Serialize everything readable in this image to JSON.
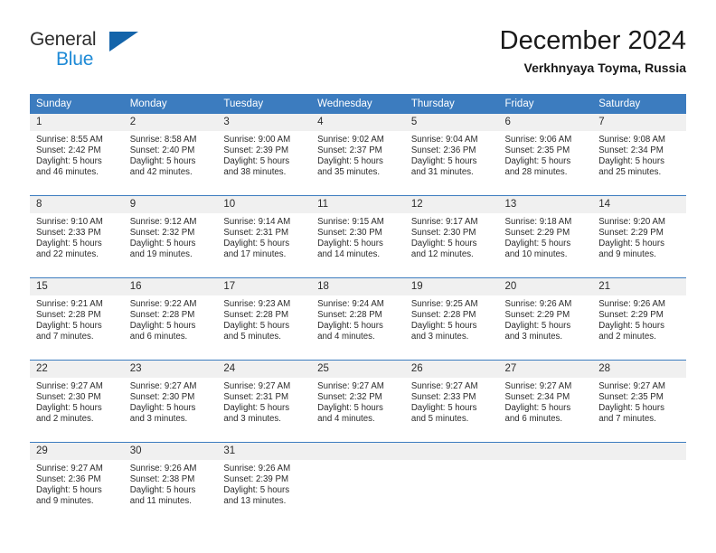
{
  "brand": {
    "name_part1": "General",
    "name_part2": "Blue",
    "triangle_color": "#1464aa",
    "blue_color": "#1e8ad6"
  },
  "header": {
    "title": "December 2024",
    "subtitle": "Verkhnyaya Toyma, Russia"
  },
  "theme": {
    "header_blue": "#3c7cbf",
    "daynum_gray": "#f0f0f0",
    "text_color": "#2b2b2b"
  },
  "weekdays": [
    "Sunday",
    "Monday",
    "Tuesday",
    "Wednesday",
    "Thursday",
    "Friday",
    "Saturday"
  ],
  "weeks": [
    [
      {
        "day": "1",
        "sunrise": "Sunrise: 8:55 AM",
        "sunset": "Sunset: 2:42 PM",
        "daylight1": "Daylight: 5 hours",
        "daylight2": "and 46 minutes."
      },
      {
        "day": "2",
        "sunrise": "Sunrise: 8:58 AM",
        "sunset": "Sunset: 2:40 PM",
        "daylight1": "Daylight: 5 hours",
        "daylight2": "and 42 minutes."
      },
      {
        "day": "3",
        "sunrise": "Sunrise: 9:00 AM",
        "sunset": "Sunset: 2:39 PM",
        "daylight1": "Daylight: 5 hours",
        "daylight2": "and 38 minutes."
      },
      {
        "day": "4",
        "sunrise": "Sunrise: 9:02 AM",
        "sunset": "Sunset: 2:37 PM",
        "daylight1": "Daylight: 5 hours",
        "daylight2": "and 35 minutes."
      },
      {
        "day": "5",
        "sunrise": "Sunrise: 9:04 AM",
        "sunset": "Sunset: 2:36 PM",
        "daylight1": "Daylight: 5 hours",
        "daylight2": "and 31 minutes."
      },
      {
        "day": "6",
        "sunrise": "Sunrise: 9:06 AM",
        "sunset": "Sunset: 2:35 PM",
        "daylight1": "Daylight: 5 hours",
        "daylight2": "and 28 minutes."
      },
      {
        "day": "7",
        "sunrise": "Sunrise: 9:08 AM",
        "sunset": "Sunset: 2:34 PM",
        "daylight1": "Daylight: 5 hours",
        "daylight2": "and 25 minutes."
      }
    ],
    [
      {
        "day": "8",
        "sunrise": "Sunrise: 9:10 AM",
        "sunset": "Sunset: 2:33 PM",
        "daylight1": "Daylight: 5 hours",
        "daylight2": "and 22 minutes."
      },
      {
        "day": "9",
        "sunrise": "Sunrise: 9:12 AM",
        "sunset": "Sunset: 2:32 PM",
        "daylight1": "Daylight: 5 hours",
        "daylight2": "and 19 minutes."
      },
      {
        "day": "10",
        "sunrise": "Sunrise: 9:14 AM",
        "sunset": "Sunset: 2:31 PM",
        "daylight1": "Daylight: 5 hours",
        "daylight2": "and 17 minutes."
      },
      {
        "day": "11",
        "sunrise": "Sunrise: 9:15 AM",
        "sunset": "Sunset: 2:30 PM",
        "daylight1": "Daylight: 5 hours",
        "daylight2": "and 14 minutes."
      },
      {
        "day": "12",
        "sunrise": "Sunrise: 9:17 AM",
        "sunset": "Sunset: 2:30 PM",
        "daylight1": "Daylight: 5 hours",
        "daylight2": "and 12 minutes."
      },
      {
        "day": "13",
        "sunrise": "Sunrise: 9:18 AM",
        "sunset": "Sunset: 2:29 PM",
        "daylight1": "Daylight: 5 hours",
        "daylight2": "and 10 minutes."
      },
      {
        "day": "14",
        "sunrise": "Sunrise: 9:20 AM",
        "sunset": "Sunset: 2:29 PM",
        "daylight1": "Daylight: 5 hours",
        "daylight2": "and 9 minutes."
      }
    ],
    [
      {
        "day": "15",
        "sunrise": "Sunrise: 9:21 AM",
        "sunset": "Sunset: 2:28 PM",
        "daylight1": "Daylight: 5 hours",
        "daylight2": "and 7 minutes."
      },
      {
        "day": "16",
        "sunrise": "Sunrise: 9:22 AM",
        "sunset": "Sunset: 2:28 PM",
        "daylight1": "Daylight: 5 hours",
        "daylight2": "and 6 minutes."
      },
      {
        "day": "17",
        "sunrise": "Sunrise: 9:23 AM",
        "sunset": "Sunset: 2:28 PM",
        "daylight1": "Daylight: 5 hours",
        "daylight2": "and 5 minutes."
      },
      {
        "day": "18",
        "sunrise": "Sunrise: 9:24 AM",
        "sunset": "Sunset: 2:28 PM",
        "daylight1": "Daylight: 5 hours",
        "daylight2": "and 4 minutes."
      },
      {
        "day": "19",
        "sunrise": "Sunrise: 9:25 AM",
        "sunset": "Sunset: 2:28 PM",
        "daylight1": "Daylight: 5 hours",
        "daylight2": "and 3 minutes."
      },
      {
        "day": "20",
        "sunrise": "Sunrise: 9:26 AM",
        "sunset": "Sunset: 2:29 PM",
        "daylight1": "Daylight: 5 hours",
        "daylight2": "and 3 minutes."
      },
      {
        "day": "21",
        "sunrise": "Sunrise: 9:26 AM",
        "sunset": "Sunset: 2:29 PM",
        "daylight1": "Daylight: 5 hours",
        "daylight2": "and 2 minutes."
      }
    ],
    [
      {
        "day": "22",
        "sunrise": "Sunrise: 9:27 AM",
        "sunset": "Sunset: 2:30 PM",
        "daylight1": "Daylight: 5 hours",
        "daylight2": "and 2 minutes."
      },
      {
        "day": "23",
        "sunrise": "Sunrise: 9:27 AM",
        "sunset": "Sunset: 2:30 PM",
        "daylight1": "Daylight: 5 hours",
        "daylight2": "and 3 minutes."
      },
      {
        "day": "24",
        "sunrise": "Sunrise: 9:27 AM",
        "sunset": "Sunset: 2:31 PM",
        "daylight1": "Daylight: 5 hours",
        "daylight2": "and 3 minutes."
      },
      {
        "day": "25",
        "sunrise": "Sunrise: 9:27 AM",
        "sunset": "Sunset: 2:32 PM",
        "daylight1": "Daylight: 5 hours",
        "daylight2": "and 4 minutes."
      },
      {
        "day": "26",
        "sunrise": "Sunrise: 9:27 AM",
        "sunset": "Sunset: 2:33 PM",
        "daylight1": "Daylight: 5 hours",
        "daylight2": "and 5 minutes."
      },
      {
        "day": "27",
        "sunrise": "Sunrise: 9:27 AM",
        "sunset": "Sunset: 2:34 PM",
        "daylight1": "Daylight: 5 hours",
        "daylight2": "and 6 minutes."
      },
      {
        "day": "28",
        "sunrise": "Sunrise: 9:27 AM",
        "sunset": "Sunset: 2:35 PM",
        "daylight1": "Daylight: 5 hours",
        "daylight2": "and 7 minutes."
      }
    ],
    [
      {
        "day": "29",
        "sunrise": "Sunrise: 9:27 AM",
        "sunset": "Sunset: 2:36 PM",
        "daylight1": "Daylight: 5 hours",
        "daylight2": "and 9 minutes."
      },
      {
        "day": "30",
        "sunrise": "Sunrise: 9:26 AM",
        "sunset": "Sunset: 2:38 PM",
        "daylight1": "Daylight: 5 hours",
        "daylight2": "and 11 minutes."
      },
      {
        "day": "31",
        "sunrise": "Sunrise: 9:26 AM",
        "sunset": "Sunset: 2:39 PM",
        "daylight1": "Daylight: 5 hours",
        "daylight2": "and 13 minutes."
      },
      {
        "day": "",
        "sunrise": "",
        "sunset": "",
        "daylight1": "",
        "daylight2": ""
      },
      {
        "day": "",
        "sunrise": "",
        "sunset": "",
        "daylight1": "",
        "daylight2": ""
      },
      {
        "day": "",
        "sunrise": "",
        "sunset": "",
        "daylight1": "",
        "daylight2": ""
      },
      {
        "day": "",
        "sunrise": "",
        "sunset": "",
        "daylight1": "",
        "daylight2": ""
      }
    ]
  ]
}
